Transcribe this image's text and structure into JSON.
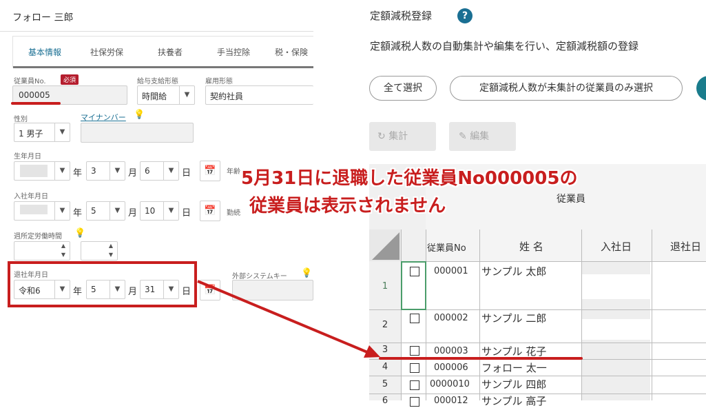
{
  "left": {
    "employee_name": "フォロー 三郎",
    "tabs": [
      {
        "label": "基本情報",
        "active": true
      },
      {
        "label": "社保労保"
      },
      {
        "label": "扶養者"
      },
      {
        "label": "手当控除"
      },
      {
        "label": "税・保険"
      }
    ],
    "fields": {
      "emp_no_label": "従業員No.",
      "required_badge": "必須",
      "emp_no_value": "000005",
      "pay_type_label": "給与支給形態",
      "pay_type_value": "時間給",
      "employment_label": "雇用形態",
      "employment_value": "契約社員",
      "gender_label": "性別",
      "gender_value": "1 男子",
      "mynumber_label": "マイナンバー",
      "birth_label": "生年月日",
      "birth_year_unit": "年",
      "birth_month": "3",
      "birth_month_unit": "月",
      "birth_day": "6",
      "birth_day_unit": "日",
      "age_label": "年齢",
      "hire_label": "入社年月日",
      "hire_year_unit": "年",
      "hire_month": "5",
      "hire_month_unit": "月",
      "hire_day": "10",
      "hire_day_unit": "日",
      "tenure_label": "勤続",
      "weekly_hours_label": "週所定労働時間",
      "retire_label": "退社年月日",
      "retire_era": "令和6",
      "retire_year_unit": "年",
      "retire_month": "5",
      "retire_month_unit": "月",
      "retire_day": "31",
      "retire_day_unit": "日",
      "external_key_label": "外部システムキー"
    }
  },
  "right": {
    "title": "定額減税登録",
    "description": "定額減税人数の自動集計や編集を行い、定額減税額の登録",
    "buttons": {
      "select_all": "全て選択",
      "select_unaggregated": "定額減税人数が未集計の従業員のみ選択",
      "aggregate": "集計",
      "edit": "編集"
    },
    "grid": {
      "group_header": "従業員",
      "columns": [
        "従業員No",
        "姓 名",
        "入社日",
        "退社日"
      ],
      "rows": [
        {
          "num": "1",
          "emp_no": "000001",
          "name": "サンプル 太郎"
        },
        {
          "num": "2",
          "emp_no": "000002",
          "name": "サンプル 二郎"
        },
        {
          "num": "3",
          "emp_no": "000003",
          "name": "サンプル 花子"
        },
        {
          "num": "4",
          "emp_no": "000006",
          "name": "フォロー 太一"
        },
        {
          "num": "5",
          "emp_no": "0000010",
          "name": "サンプル 四郎"
        },
        {
          "num": "6",
          "emp_no": "000012",
          "name": "サンプル 高子"
        }
      ]
    }
  },
  "annotation": {
    "line1": "5月31日に退職した従業員No000005の",
    "line2": "従業員は表示されません"
  },
  "colors": {
    "accent": "#1a6f93",
    "annotation_red": "#c81e1e",
    "required": "#b51e2e"
  }
}
